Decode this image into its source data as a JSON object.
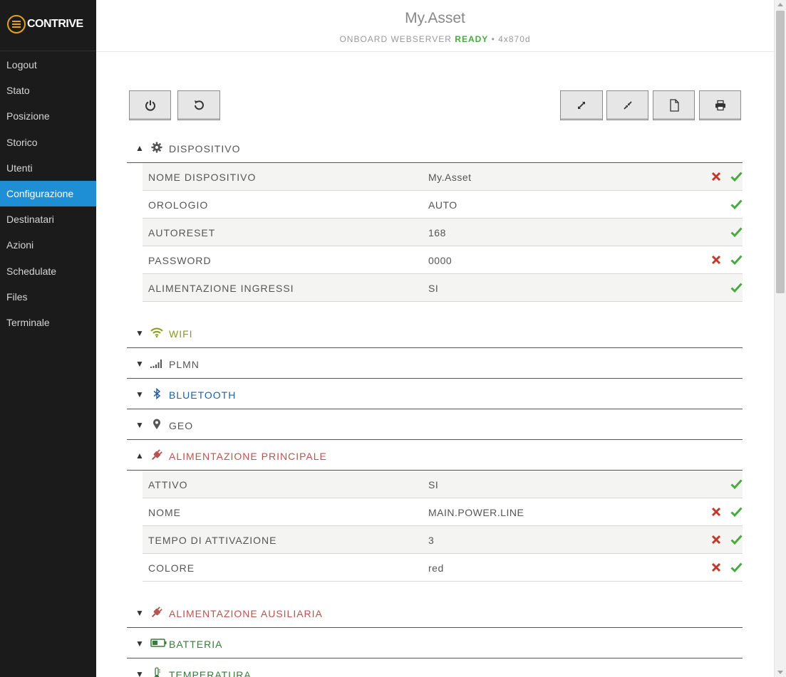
{
  "brand": {
    "name": "CONTRIVE",
    "accent": "#e3a21a"
  },
  "sidebar": {
    "items": [
      {
        "label": "Logout"
      },
      {
        "label": "Stato"
      },
      {
        "label": "Posizione"
      },
      {
        "label": "Storico"
      },
      {
        "label": "Utenti"
      },
      {
        "label": "Configurazione",
        "active": true
      },
      {
        "label": "Destinatari"
      },
      {
        "label": "Azioni"
      },
      {
        "label": "Schedulate"
      },
      {
        "label": "Files"
      },
      {
        "label": "Terminale"
      }
    ]
  },
  "header": {
    "title": "My.Asset",
    "sub_prefix": "ONBOARD WEBSERVER",
    "sub_status": "READY",
    "sub_suffix": "• 4x870d"
  },
  "toolbar": {
    "left": [
      "power-icon",
      "refresh-icon"
    ],
    "right": [
      "expand-icon",
      "collapse-icon",
      "file-icon",
      "print-icon"
    ]
  },
  "sections": {
    "dispositivo": {
      "title": "DISPOSITIVO",
      "icon": "gear-icon",
      "color": "#555555",
      "expanded": true,
      "rows": [
        {
          "label": "NOME DISPOSITIVO",
          "value": "My.Asset",
          "clear": true
        },
        {
          "label": "OROLOGIO",
          "value": "AUTO",
          "clear": false
        },
        {
          "label": "AUTORESET",
          "value": "168",
          "clear": false
        },
        {
          "label": "PASSWORD",
          "value": "0000",
          "clear": true
        },
        {
          "label": "ALIMENTAZIONE INGRESSI",
          "value": "SI",
          "clear": false
        }
      ]
    },
    "wifi": {
      "title": "WIFI",
      "icon": "wifi-icon",
      "color": "#8a9a1a",
      "expanded": false
    },
    "plmn": {
      "title": "PLMN",
      "icon": "signal-icon",
      "color": "#555555",
      "expanded": false
    },
    "bluetooth": {
      "title": "BLUETOOTH",
      "icon": "bluetooth-icon",
      "color": "#1f5fa3",
      "expanded": false
    },
    "geo": {
      "title": "GEO",
      "icon": "map-marker-icon",
      "color": "#555555",
      "expanded": false
    },
    "alimentazione_principale": {
      "title": "ALIMENTAZIONE PRINCIPALE",
      "icon": "plug-icon",
      "color": "#b85450",
      "expanded": true,
      "rows": [
        {
          "label": "ATTIVO",
          "value": "SI",
          "clear": false
        },
        {
          "label": "NOME",
          "value": "MAIN.POWER.LINE",
          "clear": true
        },
        {
          "label": "TEMPO DI ATTIVAZIONE",
          "value": "3",
          "clear": true
        },
        {
          "label": "COLORE",
          "value": "red",
          "clear": true
        }
      ]
    },
    "alimentazione_ausiliaria": {
      "title": "ALIMENTAZIONE AUSILIARIA",
      "icon": "plug-icon",
      "color": "#b85450",
      "expanded": false
    },
    "batteria": {
      "title": "BATTERIA",
      "icon": "battery-icon",
      "color": "#3a7a3a",
      "expanded": false
    },
    "temperatura": {
      "title": "TEMPERATURA",
      "icon": "thermometer-icon",
      "color": "#3a7a3a",
      "expanded": false
    }
  },
  "colors": {
    "clear": "#c0392b",
    "confirm": "#4aaa3f",
    "active_nav": "#1e8fd5"
  }
}
